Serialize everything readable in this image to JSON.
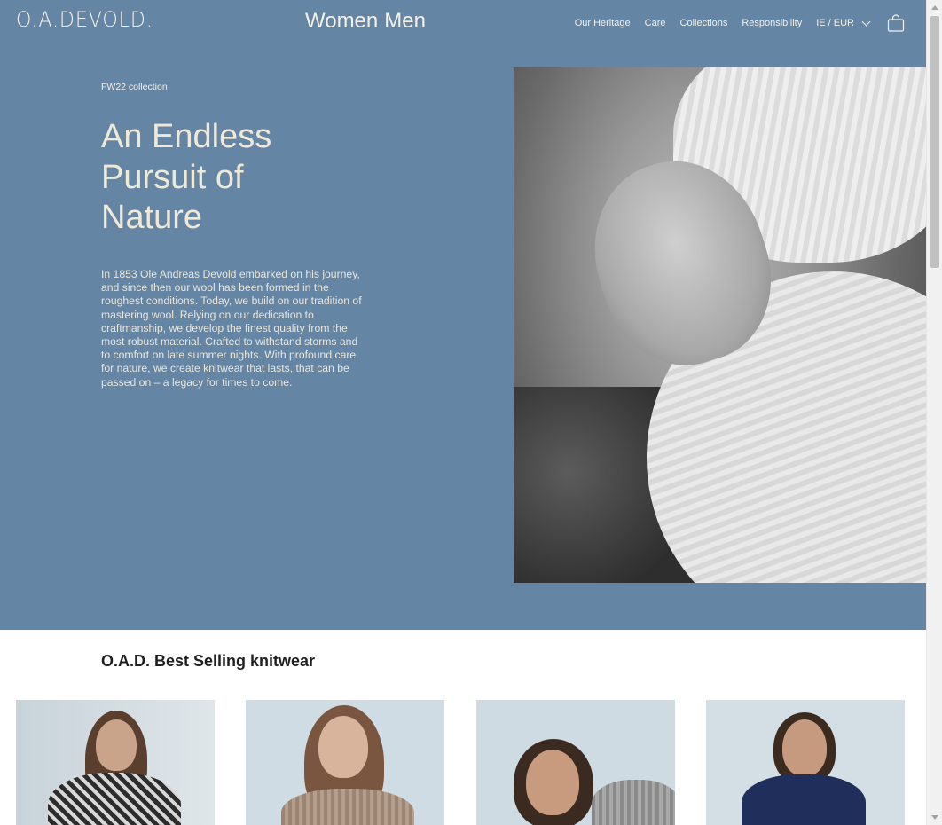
{
  "brand": {
    "logo": "O.A.DEVOLD."
  },
  "gender_nav": [
    {
      "label": "Women"
    },
    {
      "label": "Men"
    }
  ],
  "top_nav": {
    "items": [
      {
        "label": "Our Heritage"
      },
      {
        "label": "Care"
      },
      {
        "label": "Collections"
      },
      {
        "label": "Responsibility"
      }
    ],
    "region": "IE / EUR",
    "cart_icon": "shopping-bag-icon"
  },
  "hero": {
    "eyebrow": "FW22 collection",
    "headline": "An Endless Pursuit of Nature",
    "body": "In 1853 Ole Andreas Devold embarked on his journey, and since then our wool has been formed in the roughest conditions. Today, we build on our tradition of mastering wool. Relying on our dedication to craftmanship, we develop the finest quality from the most robust material. Crafted to withstand storms and to comfort on late summer nights. With profound care for nature, we create knitwear that lasts, that can be passed on – a legacy for times to come.",
    "background_color": "#6585a5",
    "text_color": "#efe9d6"
  },
  "best_sellers": {
    "title": "O.A.D. Best Selling knitwear"
  }
}
